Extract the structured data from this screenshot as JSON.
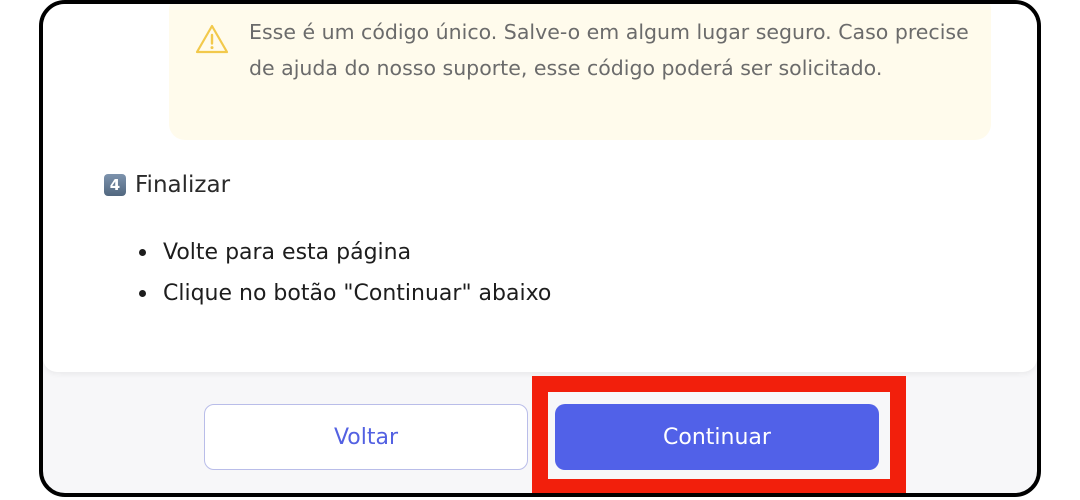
{
  "warning": {
    "icon": "warning-triangle-icon",
    "text": "Esse é um código único. Salve-o em algum lugar seguro. Caso precise de ajuda do nosso suporte, esse código poderá ser solicitado."
  },
  "step": {
    "number": "4",
    "title": "Finalizar",
    "items": [
      "Volte para esta página",
      "Clique no botão \"Continuar\" abaixo"
    ]
  },
  "buttons": {
    "back_label": "Voltar",
    "continue_label": "Continuar"
  },
  "colors": {
    "warning_bg": "#fffbec",
    "warning_icon": "#f2c94c",
    "primary": "#5161e8",
    "highlight": "#f21f0c"
  }
}
